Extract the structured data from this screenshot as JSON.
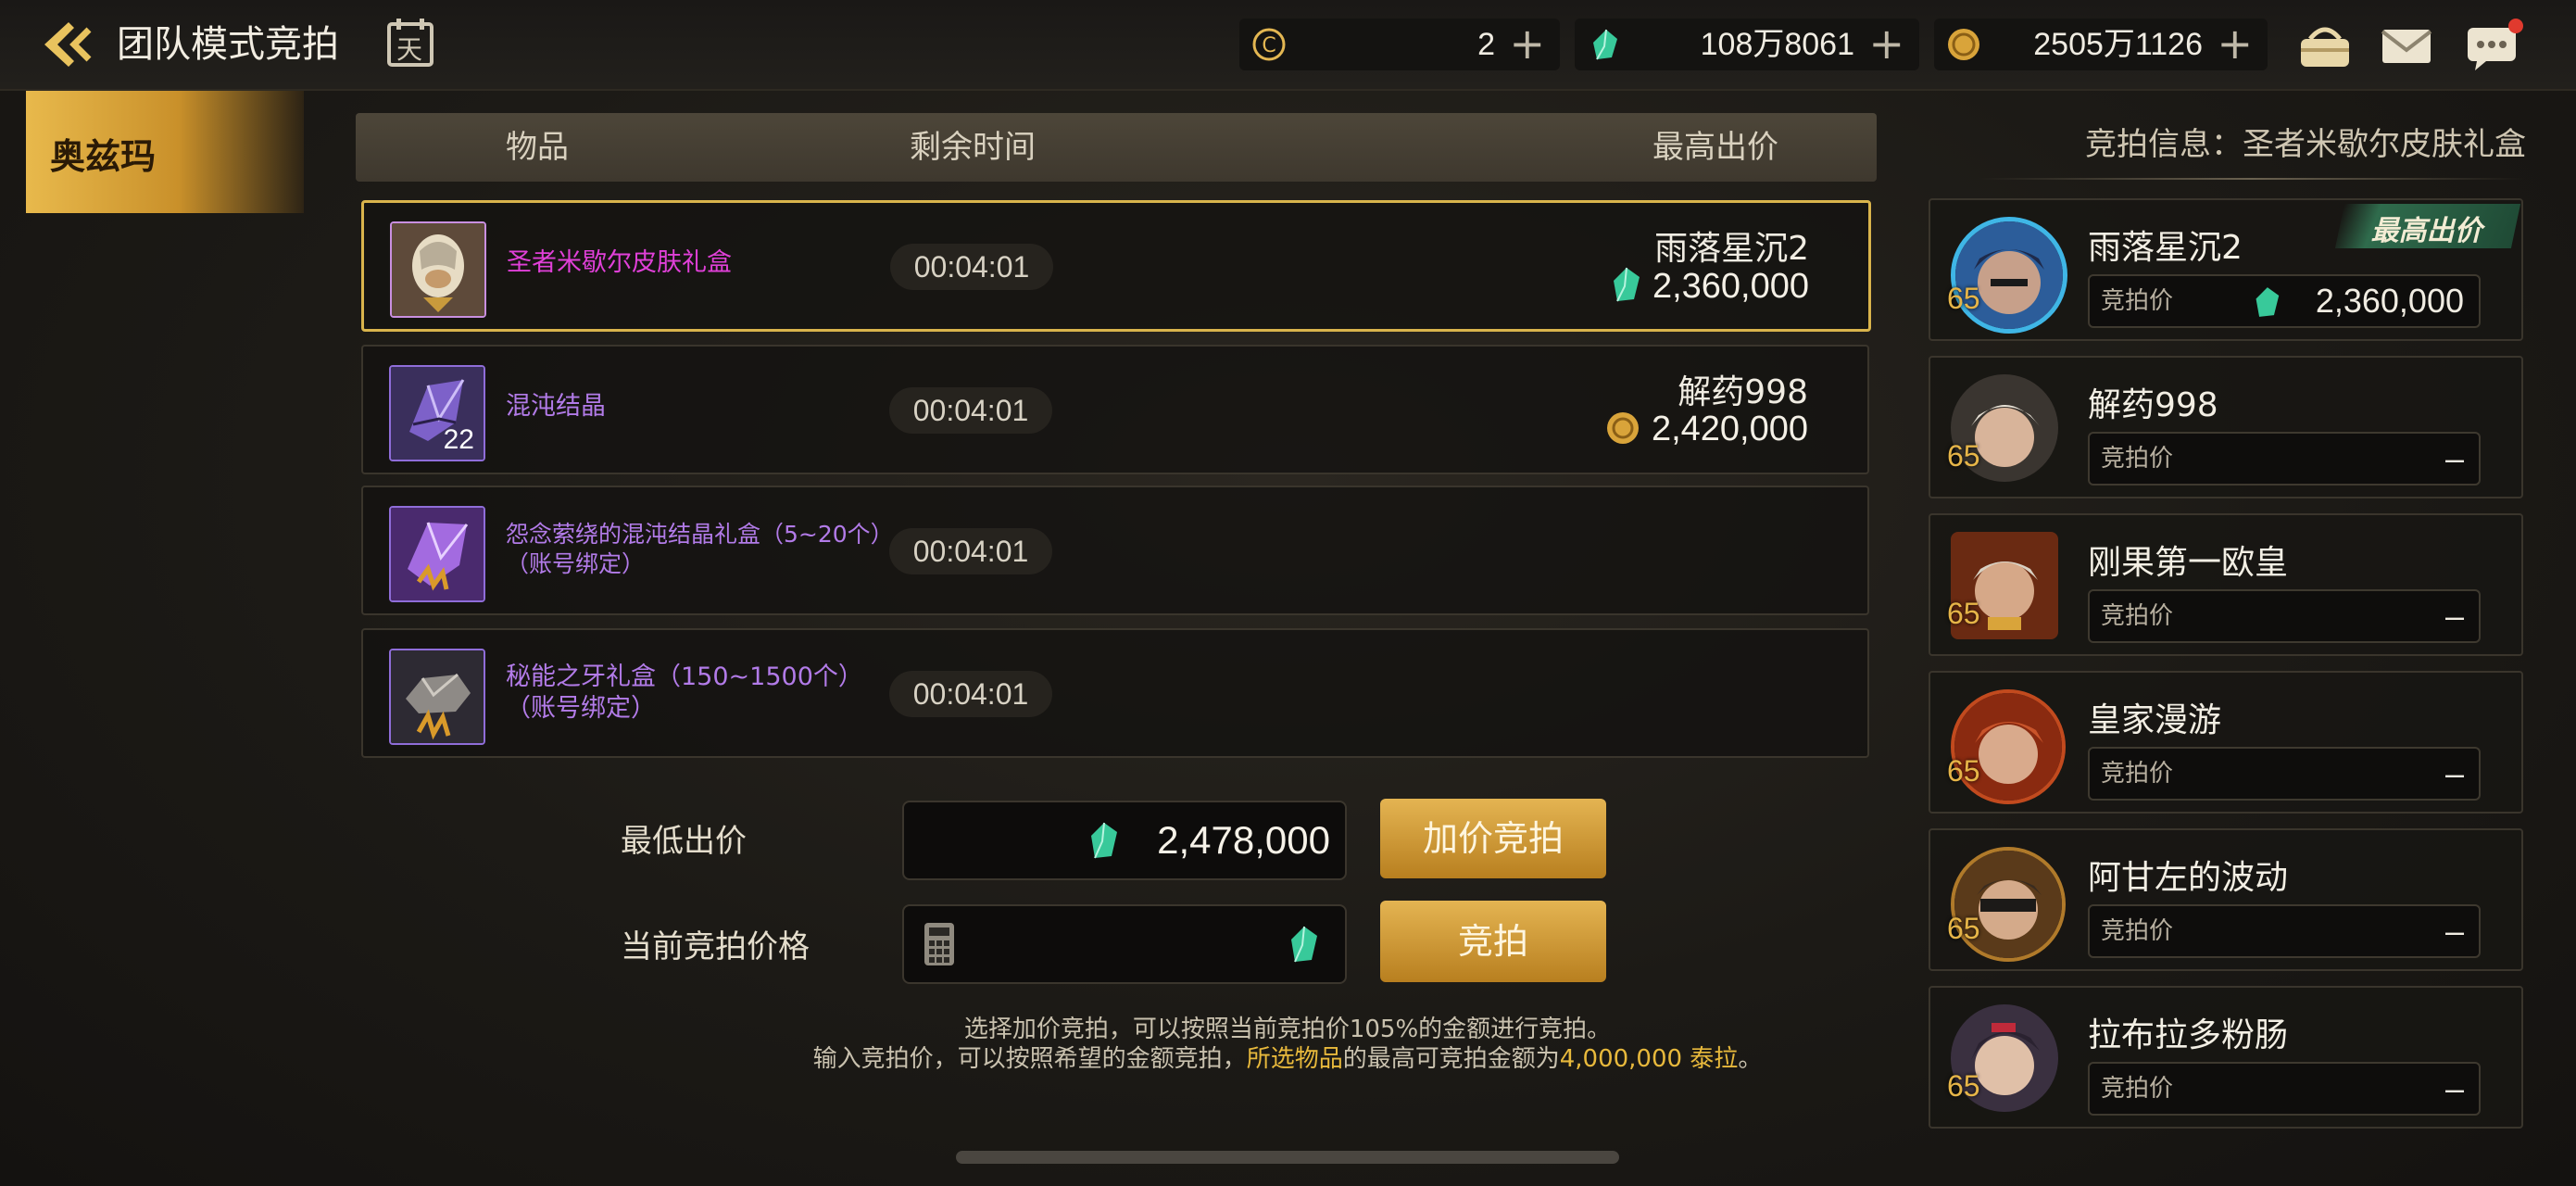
{
  "header": {
    "title": "团队模式竞拍",
    "currency": {
      "c_coin": "2",
      "crystal": "108万8061",
      "gold": "2505万1126"
    },
    "calendar_glyph": "天"
  },
  "server_tab": "奥兹玛",
  "table": {
    "columns": [
      "物品",
      "剩余时间",
      "最高出价"
    ],
    "rows": [
      {
        "name_line1": "圣者米歇尔皮肤礼盒",
        "name_line2": "",
        "time": "00:04:01",
        "bidder": "雨落星沉2",
        "price": "2,360,000",
        "price_currency": "crystal",
        "count": ""
      },
      {
        "name_line1": "混沌结晶",
        "name_line2": "",
        "time": "00:04:01",
        "bidder": "解药998",
        "price": "2,420,000",
        "price_currency": "gold",
        "count": "22"
      },
      {
        "name_line1": "怨念萦绕的混沌结晶礼盒（5~20个）",
        "name_line2": "（账号绑定）",
        "time": "00:04:01",
        "bidder": "",
        "price": "",
        "price_currency": "",
        "count": ""
      },
      {
        "name_line1": "秘能之牙礼盒（150~1500个）",
        "name_line2": "（账号绑定）",
        "time": "00:04:01",
        "bidder": "",
        "price": "",
        "price_currency": "",
        "count": ""
      }
    ]
  },
  "bid_panel": {
    "min_bid_label": "最低出价",
    "min_bid_value": "2,478,000",
    "current_label": "当前竞拍价格",
    "current_value": "",
    "raise_button": "加价竞拍",
    "bid_button": "竞拍",
    "note_line1": "选择加价竞拍，可以按照当前竞拍价105%的金额进行竞拍。",
    "note_line2_a": "输入竞拍价，可以按照希望的金额竞拍，",
    "note_line2_b": "所选物品",
    "note_line2_c": "的最高可竞拍金额为",
    "note_line2_d": "4,000,000 泰拉",
    "note_line2_e": "。"
  },
  "right_panel": {
    "info_title": "竞拍信息：圣者米歇尔皮肤礼盒",
    "top_badge": "最高出价",
    "bid_label": "竞拍价",
    "players": [
      {
        "name": "雨落星沉2",
        "level": "65",
        "bid": "2,360,000"
      },
      {
        "name": "解药998",
        "level": "65",
        "bid": "–"
      },
      {
        "name": "刚果第一欧皇",
        "level": "65",
        "bid": "–"
      },
      {
        "name": "皇家漫游",
        "level": "65",
        "bid": "–"
      },
      {
        "name": "阿甘左的波动",
        "level": "65",
        "bid": "–"
      },
      {
        "name": "拉布拉多粉肠",
        "level": "65",
        "bid": "–"
      }
    ]
  },
  "colors": {
    "accent_gold": "#d9a83c",
    "item_purple": "#b27be8",
    "item_magenta": "#e040d8",
    "crystal_green": "#3ecf9a"
  }
}
